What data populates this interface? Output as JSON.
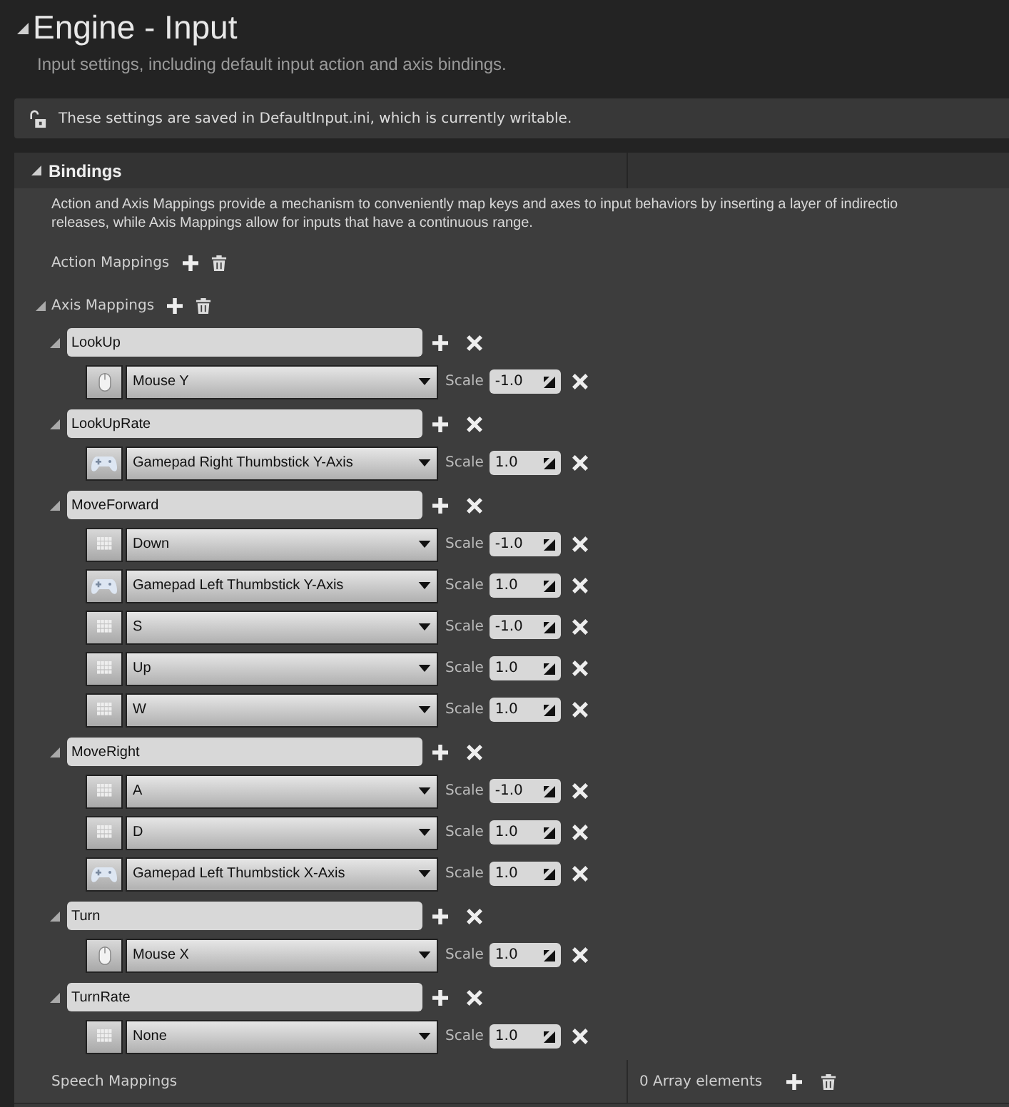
{
  "page": {
    "title": "Engine - Input",
    "expanded": true,
    "description": "Input settings, including default input action and axis bindings."
  },
  "notice": {
    "text": "These settings are saved in DefaultInput.ini, which is currently writable."
  },
  "bindings": {
    "title": "Bindings",
    "expanded": true,
    "description_lines": [
      "Action and Axis Mappings provide a mechanism to conveniently map keys and axes to input behaviors by inserting a layer of indirectio",
      "releases, while Axis Mappings allow for inputs that have a continuous range."
    ],
    "action_mappings": {
      "label": "Action Mappings"
    },
    "axis_mappings": {
      "label": "Axis Mappings",
      "expanded": true,
      "groups": [
        {
          "name": "LookUp",
          "expanded": true,
          "keys": [
            {
              "kind": "mouse",
              "key": "Mouse Y",
              "scale_label": "Scale",
              "scale": "-1.0"
            }
          ]
        },
        {
          "name": "LookUpRate",
          "expanded": true,
          "keys": [
            {
              "kind": "gamepad",
              "key": "Gamepad Right Thumbstick Y-Axis",
              "scale_label": "Scale",
              "scale": "1.0"
            }
          ]
        },
        {
          "name": "MoveForward",
          "expanded": true,
          "keys": [
            {
              "kind": "keyboard",
              "key": "Down",
              "scale_label": "Scale",
              "scale": "-1.0"
            },
            {
              "kind": "gamepad",
              "key": "Gamepad Left Thumbstick Y-Axis",
              "scale_label": "Scale",
              "scale": "1.0"
            },
            {
              "kind": "keyboard",
              "key": "S",
              "scale_label": "Scale",
              "scale": "-1.0"
            },
            {
              "kind": "keyboard",
              "key": "Up",
              "scale_label": "Scale",
              "scale": "1.0"
            },
            {
              "kind": "keyboard",
              "key": "W",
              "scale_label": "Scale",
              "scale": "1.0"
            }
          ]
        },
        {
          "name": "MoveRight",
          "expanded": true,
          "keys": [
            {
              "kind": "keyboard",
              "key": "A",
              "scale_label": "Scale",
              "scale": "-1.0"
            },
            {
              "kind": "keyboard",
              "key": "D",
              "scale_label": "Scale",
              "scale": "1.0"
            },
            {
              "kind": "gamepad",
              "key": "Gamepad Left Thumbstick X-Axis",
              "scale_label": "Scale",
              "scale": "1.0"
            }
          ]
        },
        {
          "name": "Turn",
          "expanded": true,
          "keys": [
            {
              "kind": "mouse",
              "key": "Mouse X",
              "scale_label": "Scale",
              "scale": "1.0"
            }
          ]
        },
        {
          "name": "TurnRate",
          "expanded": true,
          "keys": [
            {
              "kind": "keyboard",
              "key": "None",
              "scale_label": "Scale",
              "scale": "1.0"
            }
          ]
        }
      ]
    },
    "speech_mappings": {
      "label": "Speech Mappings",
      "count": "0 Array elements"
    }
  }
}
